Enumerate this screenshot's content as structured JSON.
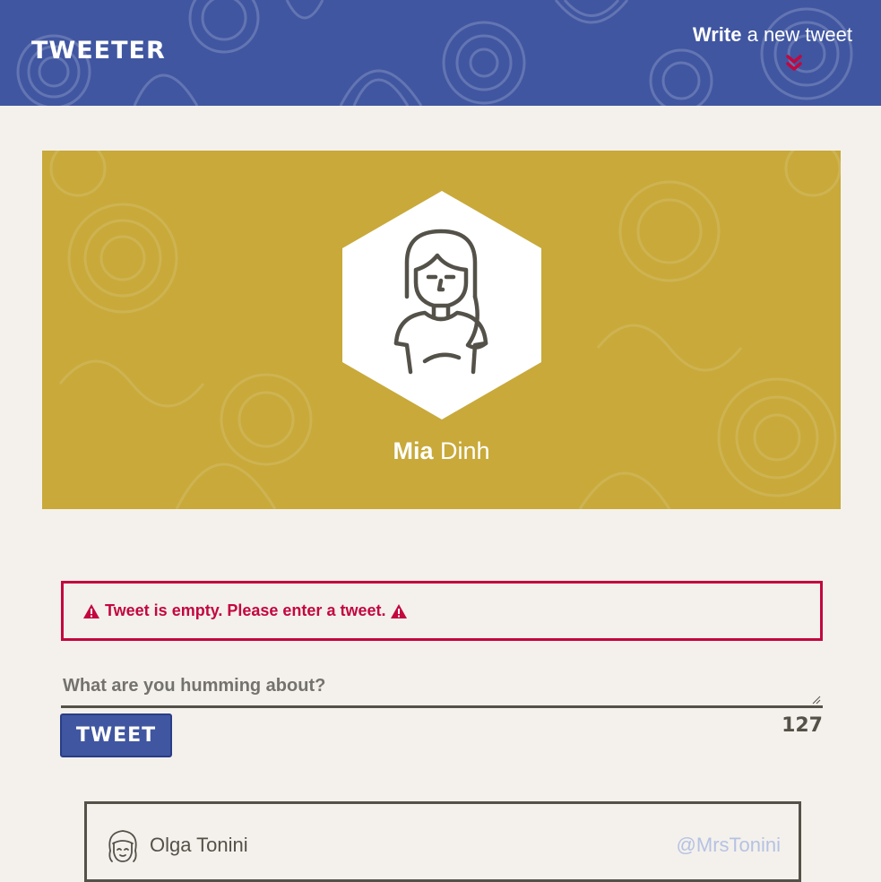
{
  "nav": {
    "brand": "TWEETER",
    "compose_strong": "Write",
    "compose_rest": " a new tweet",
    "toggle_icon": "double-chevron-down-icon",
    "accent": "#c3073f",
    "background": "#4056a1"
  },
  "profile": {
    "first_name": "Mia",
    "last_name": " Dinh",
    "avatar_icon": "girl-avatar-icon",
    "background": "#c8a93a"
  },
  "error": {
    "message": "Tweet is empty. Please enter a tweet.",
    "icon": "warning-icon",
    "color": "#c3073f"
  },
  "compose": {
    "placeholder": "What are you humming about?",
    "value": "",
    "button_label": "TWEET",
    "counter": "127"
  },
  "tweets": [
    {
      "name": "Olga Tonini",
      "handle": "@MrsTonini",
      "avatar_icon": "user-avatar-icon"
    }
  ]
}
